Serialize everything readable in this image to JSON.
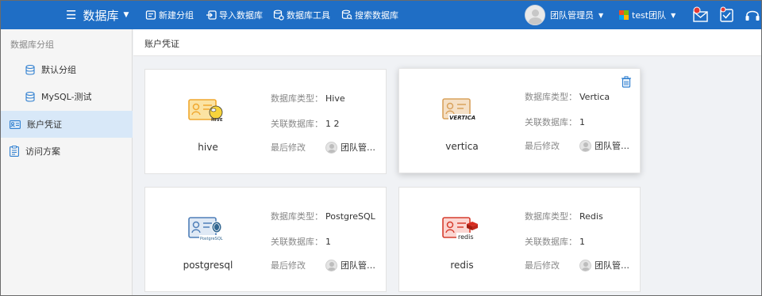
{
  "header": {
    "app_title": "数据库",
    "tools": [
      {
        "label": "新建分组",
        "icon": "new-group-icon"
      },
      {
        "label": "导入数据库",
        "icon": "import-database-icon"
      },
      {
        "label": "数据库工具",
        "icon": "database-tools-icon"
      },
      {
        "label": "搜索数据库",
        "icon": "search-database-icon"
      }
    ],
    "user_name": "团队管理员",
    "team_name": "test团队",
    "colors": {
      "bar": "#1f6ec5",
      "notify_dot": "#e53935"
    }
  },
  "sidebar": {
    "heading": "数据库分组",
    "items": [
      {
        "label": "默认分组",
        "icon": "database-icon",
        "active": false
      },
      {
        "label": "MySQL-测试",
        "icon": "database-icon",
        "active": false
      },
      {
        "label": "账户凭证",
        "icon": "credential-card-icon",
        "active": true
      },
      {
        "label": "访问方案",
        "icon": "access-plan-icon",
        "active": false
      }
    ]
  },
  "breadcrumb": "账户凭证",
  "labels": {
    "db_type": "数据库类型：",
    "linked_db": "关联数据库：",
    "last_modified": "最后修改"
  },
  "cards": [
    {
      "name": "hive",
      "db_type": "Hive",
      "linked_count": "1 2",
      "modifier": "团队管…",
      "logo": "hive-logo",
      "logo_text": "HIVE"
    },
    {
      "name": "vertica",
      "db_type": "Vertica",
      "linked_count": "1",
      "modifier": "团队管…",
      "logo": "vertica-logo",
      "logo_text": "VERTICA"
    },
    {
      "name": "postgresql",
      "db_type": "PostgreSQL",
      "linked_count": "1",
      "modifier": "团队管…",
      "logo": "postgresql-logo",
      "logo_text": "PostgreSQL"
    },
    {
      "name": "redis",
      "db_type": "Redis",
      "linked_count": "1",
      "modifier": "团队管…",
      "logo": "redis-logo",
      "logo_text": "redis"
    }
  ]
}
